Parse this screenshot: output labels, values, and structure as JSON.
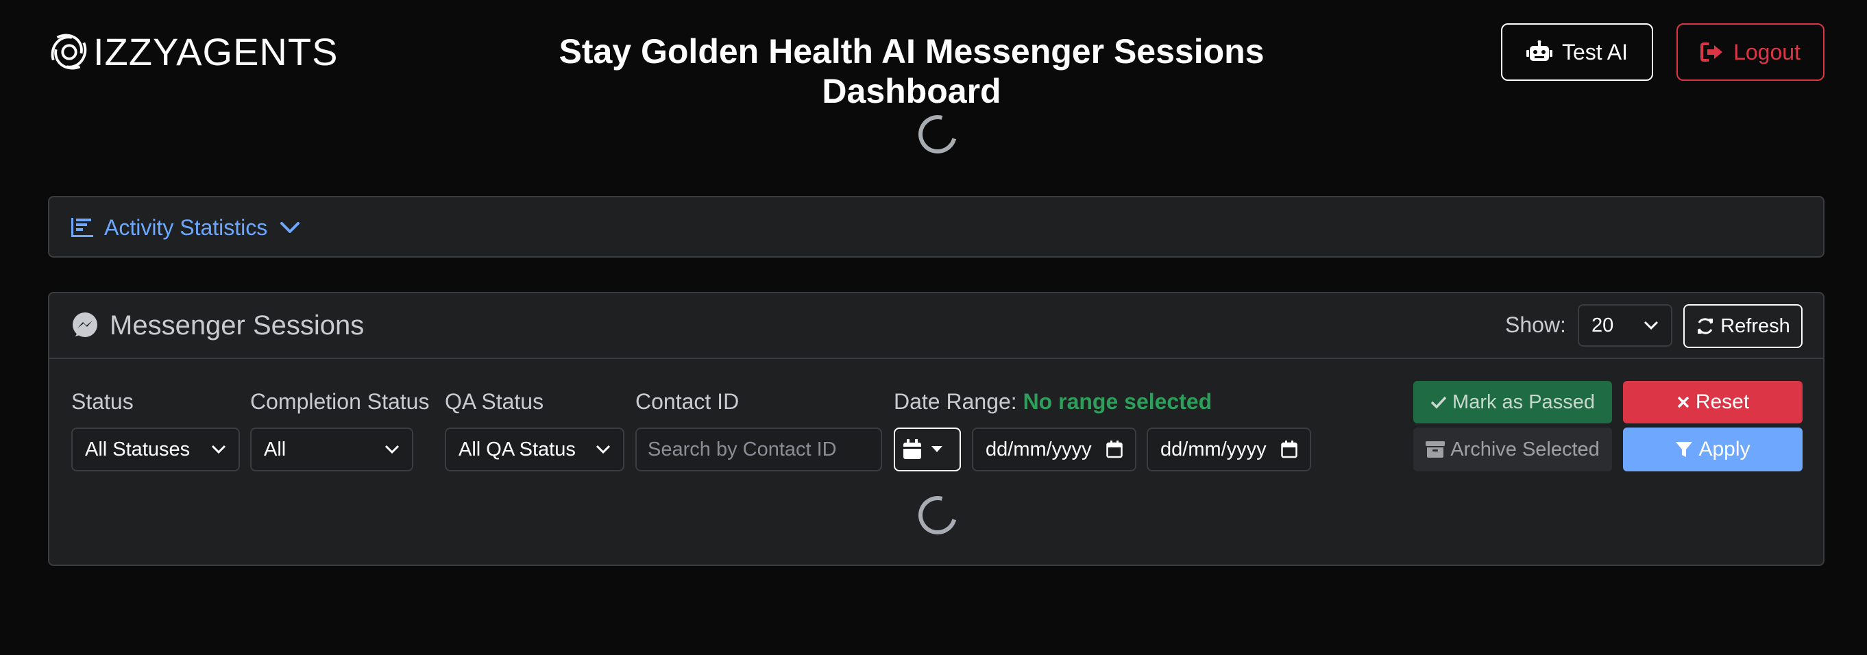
{
  "header": {
    "logo_text": "IZZYAGENTS",
    "title": "Stay Golden Health AI Messenger Sessions Dashboard",
    "test_ai_label": "Test AI",
    "logout_label": "Logout"
  },
  "stats": {
    "toggle_label": "Activity Statistics"
  },
  "sessions": {
    "title": "Messenger Sessions",
    "show_label": "Show:",
    "show_value": "20",
    "refresh_label": "Refresh"
  },
  "filters": {
    "status": {
      "label": "Status",
      "value": "All Statuses"
    },
    "completion": {
      "label": "Completion Status",
      "value": "All"
    },
    "qa": {
      "label": "QA Status",
      "value": "All QA Status"
    },
    "contact": {
      "label": "Contact ID",
      "placeholder": "Search by Contact ID"
    },
    "date_range": {
      "label": "Date Range:",
      "status": "No range selected",
      "start_placeholder": "dd/mm/yyyy",
      "end_placeholder": "dd/mm/yyyy"
    }
  },
  "actions": {
    "mark_passed": "Mark as Passed",
    "reset": "Reset",
    "archive": "Archive Selected",
    "apply": "Apply"
  },
  "colors": {
    "accent": "#6ea8fe",
    "danger": "#dc3545",
    "success": "#1e6b44",
    "range_status": "#2e9e5b"
  }
}
